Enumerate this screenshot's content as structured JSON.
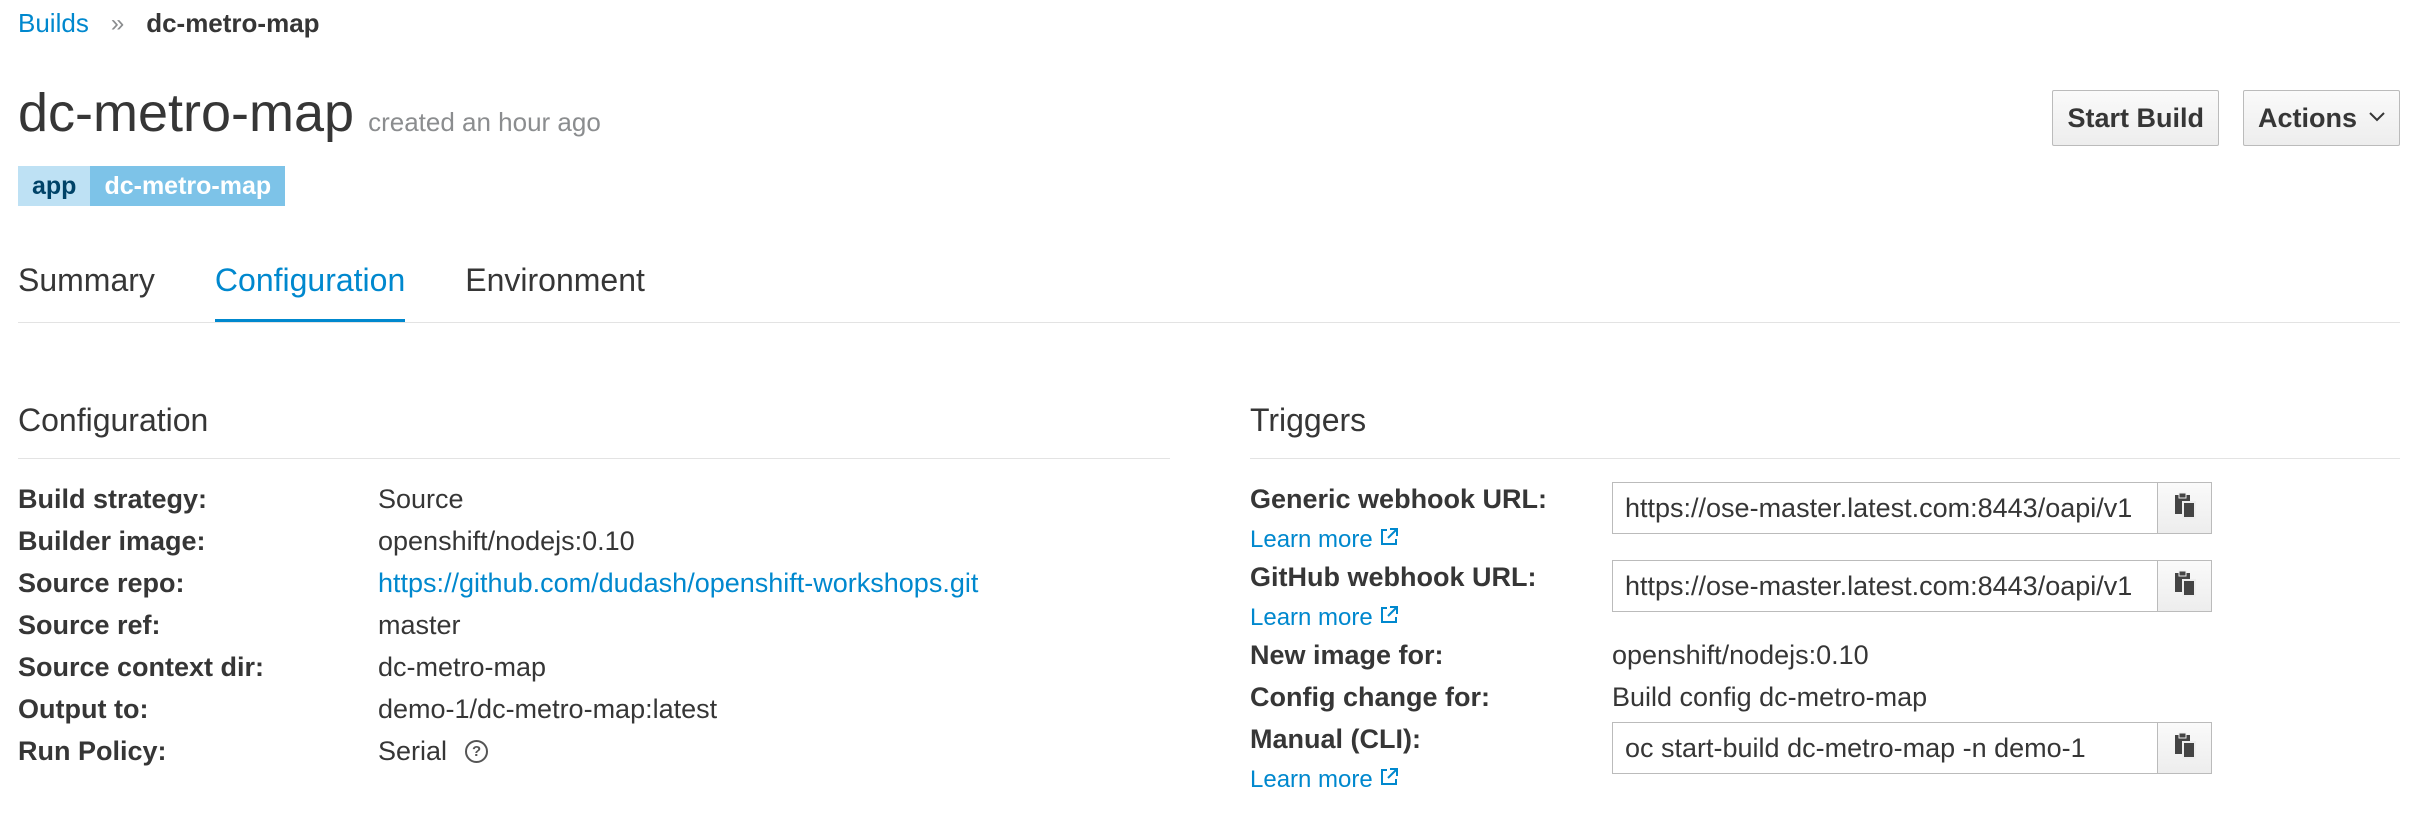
{
  "breadcrumb": {
    "parent": "Builds",
    "separator": "»",
    "current": "dc-metro-map"
  },
  "header": {
    "title": "dc-metro-map",
    "subtitle": "created an hour ago"
  },
  "actions": {
    "start_build": "Start Build",
    "actions": "Actions"
  },
  "labels": [
    {
      "key": "app",
      "value": "dc-metro-map"
    }
  ],
  "tabs": [
    {
      "label": "Summary",
      "active": false
    },
    {
      "label": "Configuration",
      "active": true
    },
    {
      "label": "Environment",
      "active": false
    }
  ],
  "configuration": {
    "title": "Configuration",
    "rows": [
      {
        "key": "Build strategy:",
        "value": "Source"
      },
      {
        "key": "Builder image:",
        "value": "openshift/nodejs:0.10"
      },
      {
        "key": "Source repo:",
        "value": "https://github.com/dudash/openshift-workshops.git"
      },
      {
        "key": "Source ref:",
        "value": "master"
      },
      {
        "key": "Source context dir:",
        "value": "dc-metro-map"
      },
      {
        "key": "Output to:",
        "value": "demo-1/dc-metro-map:latest"
      },
      {
        "key": "Run Policy:",
        "value": "Serial"
      }
    ]
  },
  "triggers": {
    "title": "Triggers",
    "learn_more": "Learn more",
    "generic_webhook": {
      "key": "Generic webhook URL:",
      "value": "https://ose-master.latest.com:8443/oapi/v1"
    },
    "github_webhook": {
      "key": "GitHub webhook URL:",
      "value": "https://ose-master.latest.com:8443/oapi/v1"
    },
    "new_image": {
      "key": "New image for:",
      "value": "openshift/nodejs:0.10"
    },
    "config_change": {
      "key": "Config change for:",
      "value": "Build config dc-metro-map"
    },
    "manual_cli": {
      "key": "Manual (CLI):",
      "value": "oc start-build dc-metro-map -n demo-1"
    }
  },
  "colors": {
    "link": "#0088ce",
    "label_key_bg": "#bee1f4",
    "label_value_bg": "#7dc3e8"
  }
}
